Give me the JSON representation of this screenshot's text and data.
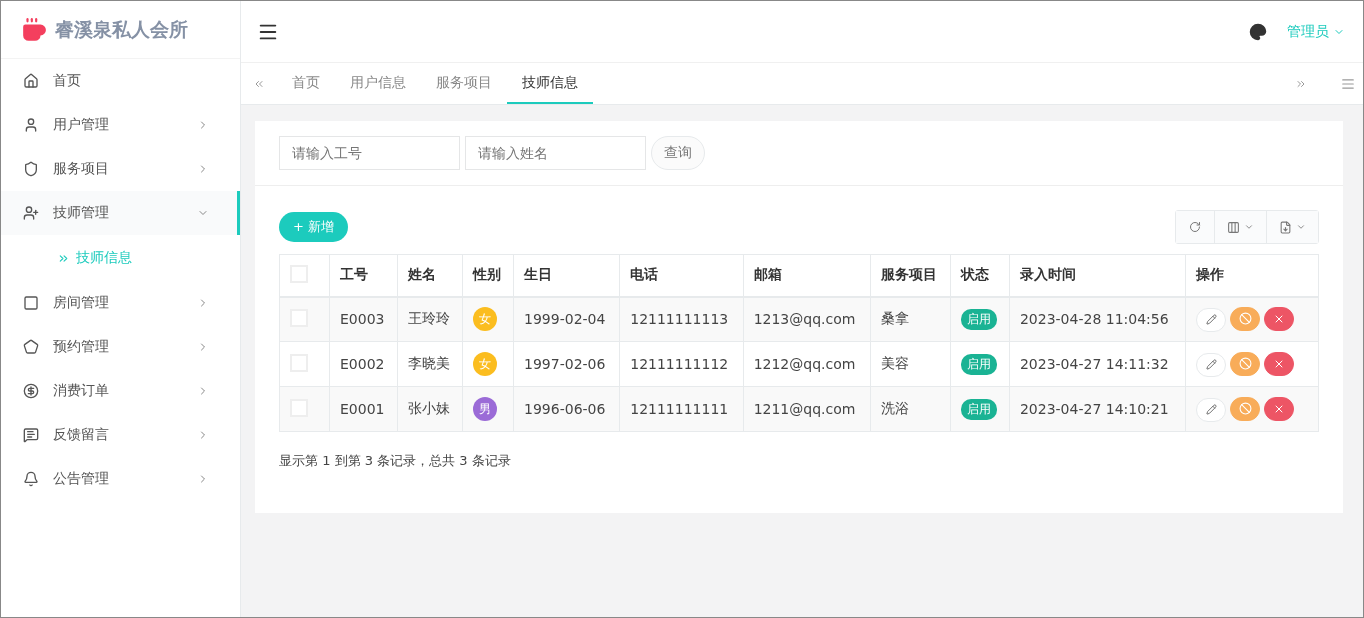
{
  "brand": {
    "name": "睿溪泉私人会所"
  },
  "sidebar": {
    "items": [
      {
        "label": "首页",
        "kind": "link",
        "selected": false
      },
      {
        "label": "用户管理",
        "kind": "menu",
        "expanded": false,
        "selected": false
      },
      {
        "label": "服务项目",
        "kind": "menu",
        "expanded": false,
        "selected": false
      },
      {
        "label": "技师管理",
        "kind": "menu",
        "expanded": true,
        "selected": true,
        "children": [
          {
            "label": "技师信息",
            "selected": true
          }
        ]
      },
      {
        "label": "房间管理",
        "kind": "menu",
        "expanded": false,
        "selected": false
      },
      {
        "label": "预约管理",
        "kind": "menu",
        "expanded": false,
        "selected": false
      },
      {
        "label": "消费订单",
        "kind": "menu",
        "expanded": false,
        "selected": false
      },
      {
        "label": "反馈留言",
        "kind": "menu",
        "expanded": false,
        "selected": false
      },
      {
        "label": "公告管理",
        "kind": "menu",
        "expanded": false,
        "selected": false
      }
    ]
  },
  "header": {
    "user": "管理员"
  },
  "tabs": [
    {
      "label": "首页",
      "selected": false
    },
    {
      "label": "用户信息",
      "selected": false
    },
    {
      "label": "服务项目",
      "selected": false
    },
    {
      "label": "技师信息",
      "selected": true
    }
  ],
  "search": {
    "fields": [
      {
        "placeholder": "请输入工号"
      },
      {
        "placeholder": "请输入姓名"
      }
    ],
    "button": "查询"
  },
  "add_button": "+ 新增",
  "table": {
    "columns": [
      "工号",
      "姓名",
      "性别",
      "生日",
      "电话",
      "邮箱",
      "服务项目",
      "状态",
      "录入时间",
      "操作"
    ],
    "rows": [
      {
        "checked": false,
        "id": "E0003",
        "name": "王玲玲",
        "gender": {
          "label": "女",
          "color": "#fbbd1f"
        },
        "birthday": "1999-02-04",
        "phone": "12111111113",
        "email": "1213@qq.com",
        "service": "桑拿",
        "status": {
          "label": "启用",
          "enabled": true
        },
        "created": "2023-04-28 11:04:56"
      },
      {
        "checked": false,
        "id": "E0002",
        "name": "李晓美",
        "gender": {
          "label": "女",
          "color": "#fbbd1f"
        },
        "birthday": "1997-02-06",
        "phone": "12111111112",
        "email": "1212@qq.com",
        "service": "美容",
        "status": {
          "label": "启用",
          "enabled": true
        },
        "created": "2023-04-27 14:11:32"
      },
      {
        "checked": false,
        "id": "E0001",
        "name": "张小妹",
        "gender": {
          "label": "男",
          "color": "#9b6bd7"
        },
        "birthday": "1996-06-06",
        "phone": "12111111111",
        "email": "1211@qq.com",
        "service": "洗浴",
        "status": {
          "label": "启用",
          "enabled": true
        },
        "created": "2023-04-27 14:10:21"
      }
    ],
    "all_checked": false
  },
  "pagination": "显示第 1 到第 3 条记录，总共 3 条记录"
}
